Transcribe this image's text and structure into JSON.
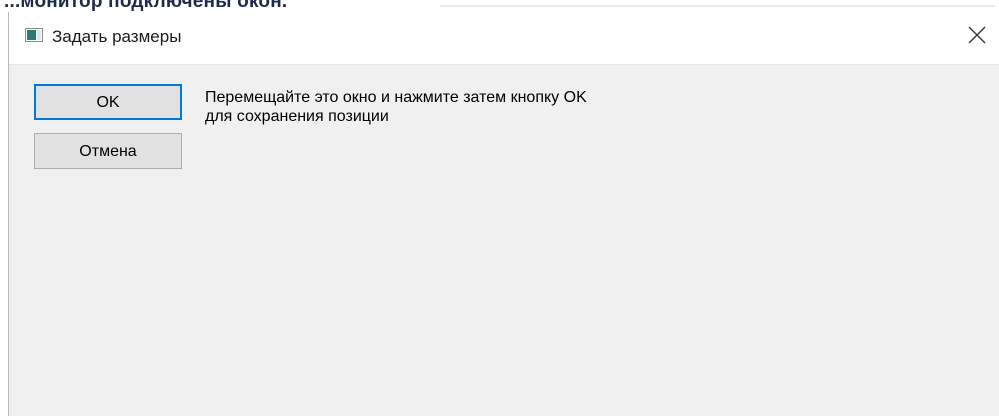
{
  "background": {
    "partial_text": "...монитор подключены окон."
  },
  "window": {
    "title": "Задать размеры",
    "icon": "window-app-icon",
    "close_icon": "close-icon",
    "buttons": {
      "ok_label": "OK",
      "cancel_label": "Отмена"
    },
    "message": {
      "line1": "Перемещайте это окно и нажмите затем кнопку OK",
      "line2": "для сохранения позиции"
    },
    "colors": {
      "accent": "#0078d7",
      "client_background": "#f0f0f0",
      "titlebar_background": "#ffffff",
      "button_face": "#e1e1e1"
    }
  }
}
